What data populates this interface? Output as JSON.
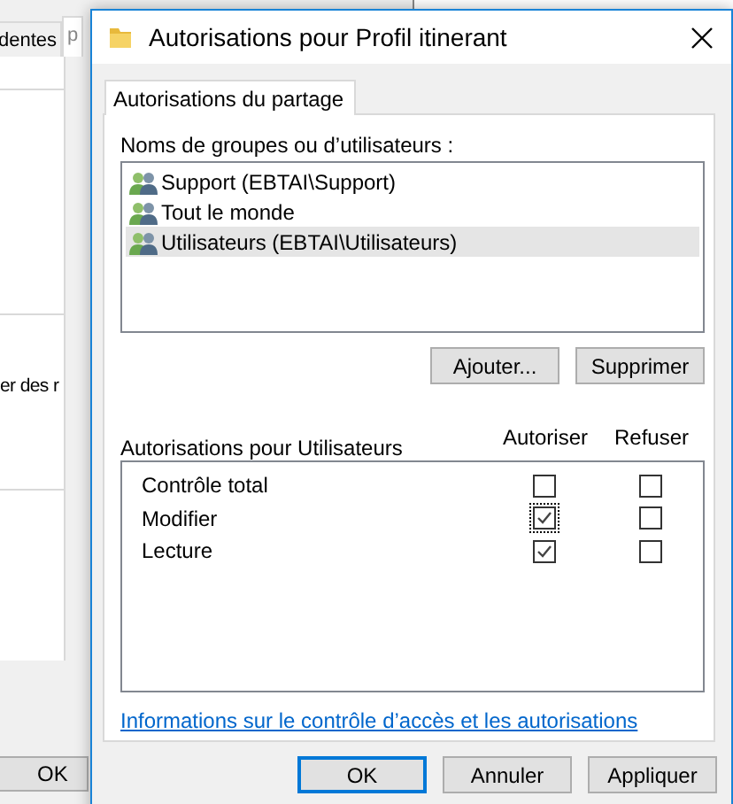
{
  "background_window": {
    "tabs": [
      {
        "label": "dentes",
        "selected": false
      },
      {
        "label": "p",
        "selected": true
      }
    ],
    "text": "er des r",
    "button": "OK"
  },
  "dialog": {
    "title": "Autorisations pour Profil itinerant",
    "tabs": [
      {
        "label": "Autorisations du partage",
        "selected": true
      }
    ],
    "principals_label": "Noms de groupes ou d’utilisateurs :",
    "principals": [
      {
        "name": "Support (EBTAI\\Support)",
        "selected": false
      },
      {
        "name": "Tout le monde",
        "selected": false
      },
      {
        "name": "Utilisateurs (EBTAI\\Utilisateurs)",
        "selected": true
      }
    ],
    "add_button": "Ajouter...",
    "remove_button": "Supprimer",
    "permissions_label": "Autorisations pour Utilisateurs",
    "columns": [
      "Autoriser",
      "Refuser"
    ],
    "permissions": [
      {
        "name": "Contrôle total",
        "allow": false,
        "deny": false,
        "focused": false
      },
      {
        "name": "Modifier",
        "allow": true,
        "deny": false,
        "focused": true
      },
      {
        "name": "Lecture",
        "allow": true,
        "deny": false,
        "focused": false
      }
    ],
    "link": "Informations sur le contrôle d’accès et les autorisations",
    "buttons": [
      {
        "label": "OK",
        "default": true
      },
      {
        "label": "Annuler",
        "default": false
      },
      {
        "label": "Appliquer",
        "default": false
      }
    ]
  }
}
